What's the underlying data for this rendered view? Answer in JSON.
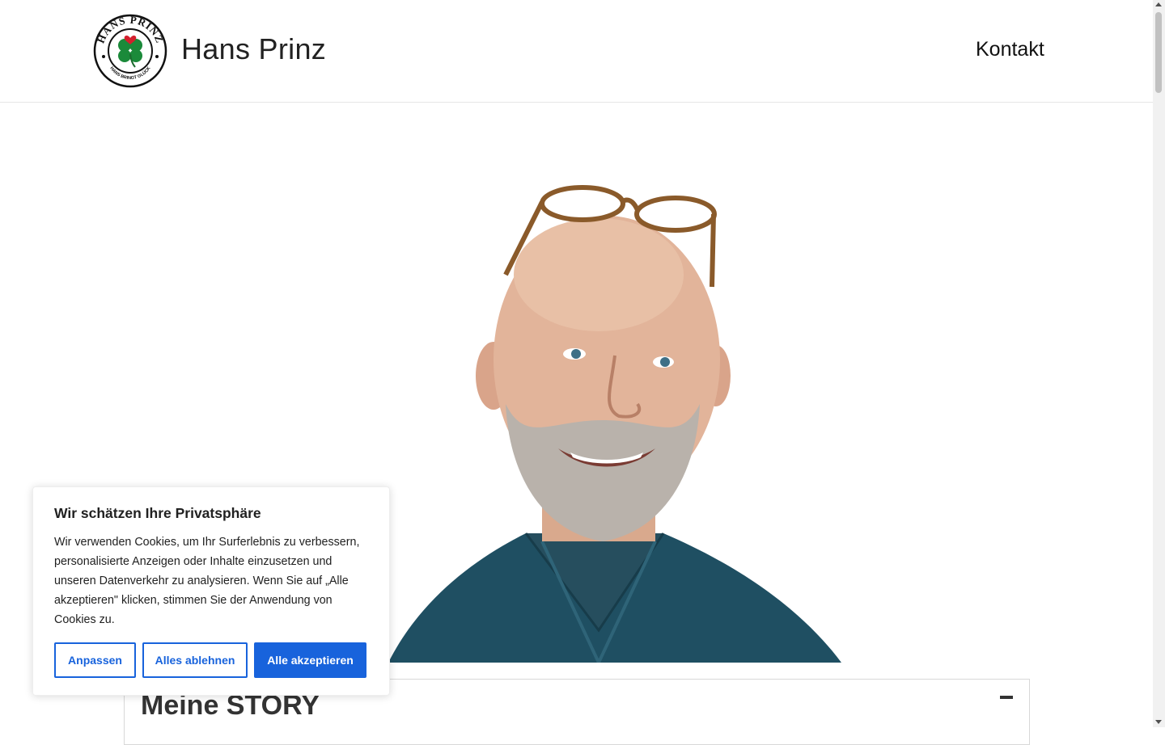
{
  "header": {
    "site_title": "Hans Prinz",
    "nav": {
      "kontakt_label": "Kontakt"
    },
    "logo": {
      "top_text": "HANS PRINZ",
      "bottom_text": "HANS BRINGT GLÜCK",
      "icon": "four-leaf-clover-icon"
    }
  },
  "hero": {
    "image": "portrait-photo"
  },
  "story": {
    "title": "Meine STORY",
    "toggle_icon": "minus-icon"
  },
  "cookie_banner": {
    "title": "Wir schätzen Ihre Privatsphäre",
    "text": "Wir verwenden Cookies, um Ihr Surferlebnis zu verbessern, personalisierte Anzeigen oder Inhalte einzusetzen und unseren Datenverkehr zu analysieren. Wenn Sie auf „Alle akzeptieren\" klicken, stimmen Sie der Anwendung von Cookies zu.",
    "buttons": {
      "customize": "Anpassen",
      "reject": "Alles ablehnen",
      "accept": "Alle akzeptieren"
    },
    "accent_color": "#1863dc"
  }
}
